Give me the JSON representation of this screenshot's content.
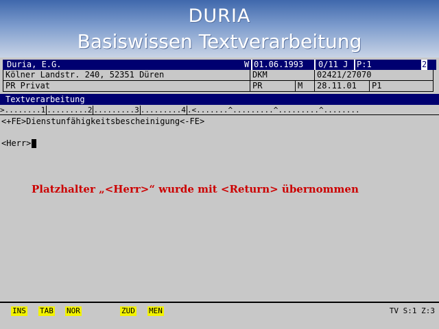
{
  "slide": {
    "title": "DURIA",
    "subtitle": "Basiswissen Textverarbeitung"
  },
  "record": {
    "name": "Duria, E.G.",
    "flag": "W",
    "date": "01.06.1993",
    "code": "0/11 J",
    "page": "P:1",
    "count": "2"
  },
  "address_row": {
    "address": "Kölner Landstr. 240, 52351 Düren",
    "insurer": "DKM",
    "phone": "02421/27070"
  },
  "status_row": {
    "status": "PR Privat",
    "abbr": "PR",
    "gender": "M",
    "date": "28.11.01",
    "mark": "P1"
  },
  "section": {
    "title": "Textverarbeitung"
  },
  "ruler": {
    "seg1": ">........1",
    "seg2": ".........2",
    "seg3": ".........3",
    "seg4": ".........4",
    "rest": ".<.......^.........^.........^........"
  },
  "document": {
    "line1": "<+FE>Dienstunfähigkeitsbescheinigung<-FE>",
    "line2": "<Herr>"
  },
  "annotation": {
    "text": "Platzhalter „<Herr>“ wurde mit <Return> übernommen"
  },
  "function_keys": {
    "ins": "INS",
    "tab": "TAB",
    "nor": "NOR",
    "zud": "ZUD",
    "men": "MEN"
  },
  "status": {
    "info": "TV S:1 Z:3"
  },
  "colors": {
    "header_blue": "#000070",
    "fkey_yellow": "#f2f200",
    "annotation_red": "#cc0000",
    "background": "#c8c8c8"
  }
}
